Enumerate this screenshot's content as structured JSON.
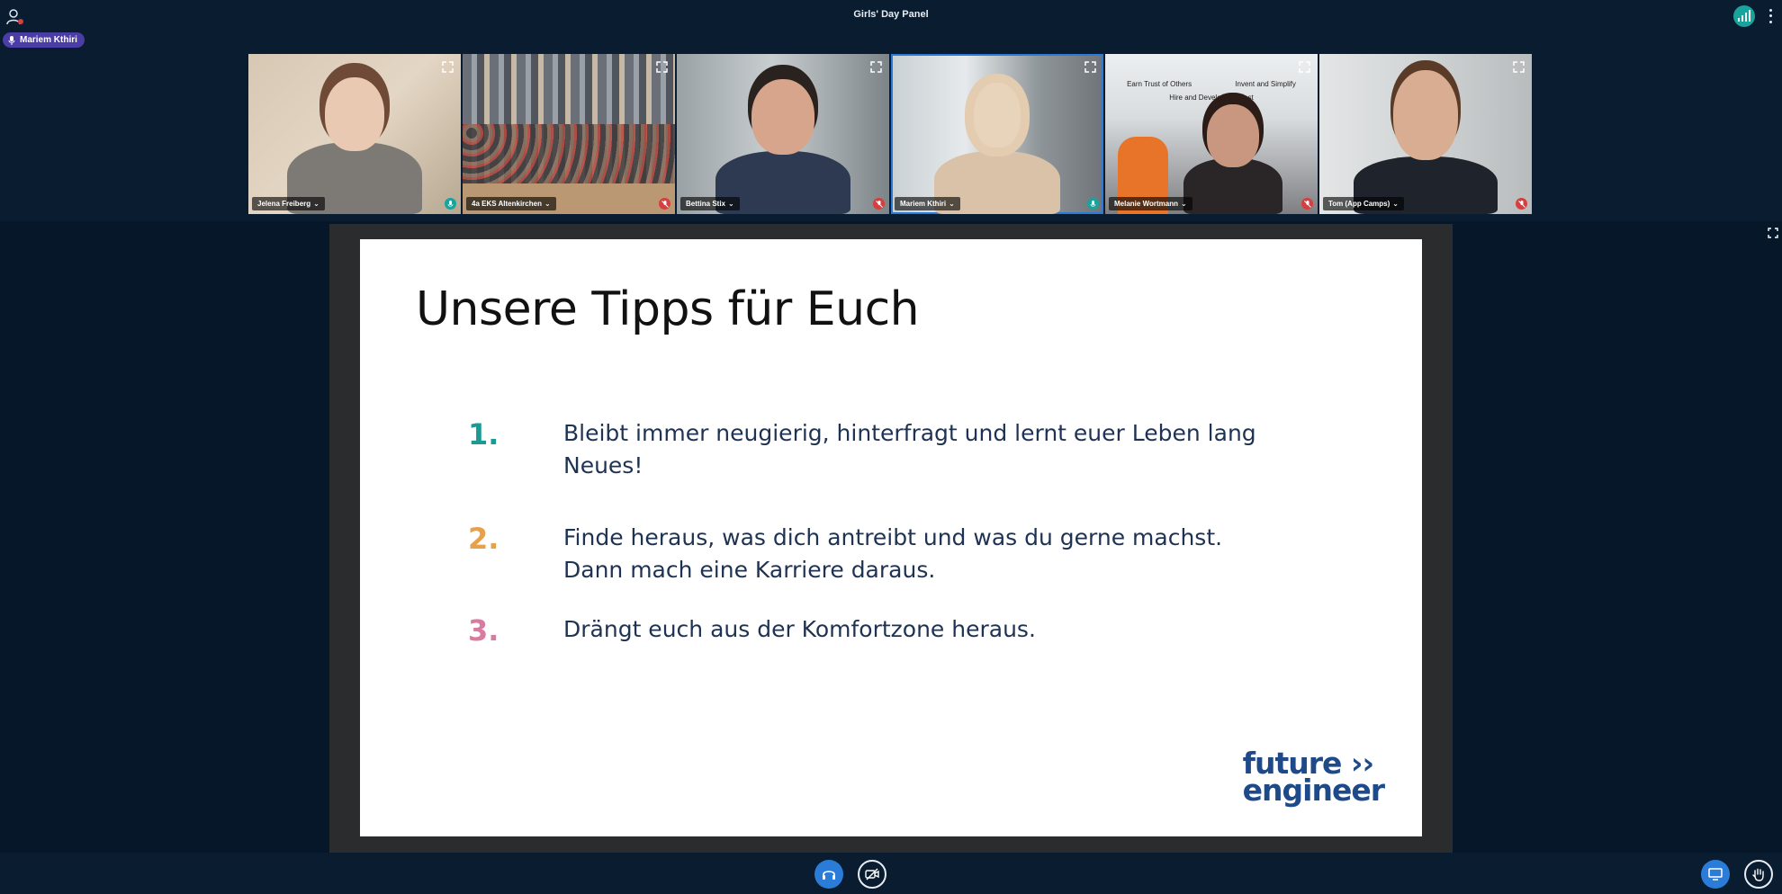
{
  "meeting": {
    "title": "Girls' Day Panel"
  },
  "talker": {
    "name": "Mariem Kthiri"
  },
  "tiles": [
    {
      "name": "Jelena Freiberg",
      "mic": "on"
    },
    {
      "name": "4a EKS Altenkirchen",
      "mic": "off"
    },
    {
      "name": "Bettina Stix",
      "mic": "off"
    },
    {
      "name": "Mariem Kthiri",
      "mic": "on"
    },
    {
      "name": "Melanie Wortmann",
      "mic": "off"
    },
    {
      "name": "Tom (App Camps)",
      "mic": "off"
    }
  ],
  "office_sign": {
    "line1": "Earn Trust of Others",
    "line2": "Invent and Simplify",
    "line3": "Hire and Develop the Best"
  },
  "slide": {
    "title": "Unsere Tipps für Euch",
    "tips": [
      {
        "number": "1.",
        "color": "#1a9a93",
        "text": "Bleibt immer neugierig, hinterfragt und lernt euer Leben lang Neues!"
      },
      {
        "number": "2.",
        "color": "#e8a04a",
        "text": "Finde heraus, was dich antreibt und was du gerne machst. Dann mach eine Karriere daraus."
      },
      {
        "number": "3.",
        "color": "#d97aa0",
        "text": "Drängt euch aus der Komfortzone heraus."
      }
    ],
    "logo": {
      "line1": "future ››",
      "line2": "engineer"
    }
  },
  "colors": {
    "accent_blue": "#2a7cd8",
    "mic_on": "#1aa39c",
    "mic_off": "#d63f3f",
    "background": "#06172a"
  }
}
